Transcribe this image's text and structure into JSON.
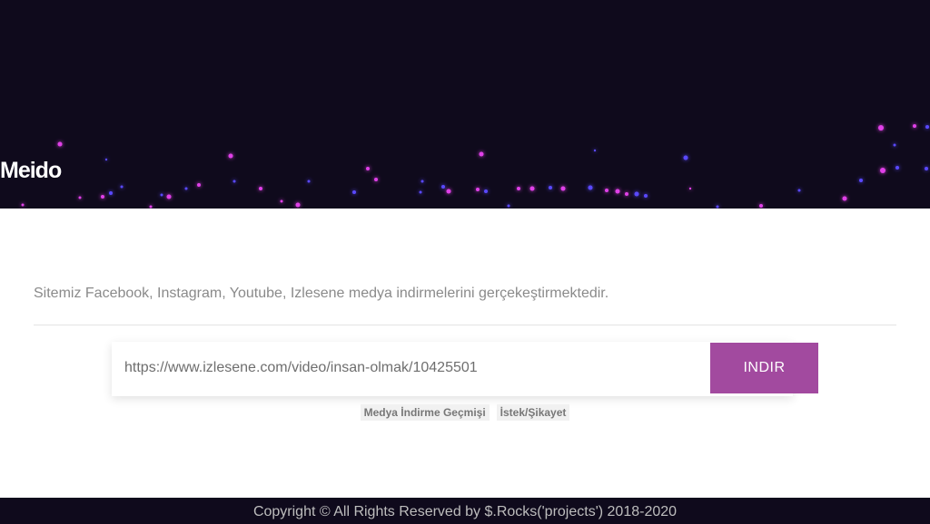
{
  "brand": {
    "logo": "Meido"
  },
  "main": {
    "intro": "Sitemiz Facebook, Instagram, Youtube, Izlesene medya indirmelerini gerçekeştirmektedir.",
    "url_value": "https://www.izlesene.com/video/insan-olmak/10425501",
    "download_label": "INDIR"
  },
  "links": {
    "history": "Medya İndirme Geçmişi",
    "complaint": "İstek/Şikayet"
  },
  "footer": {
    "copyright": "Copyright © All Rights Reserved by $.Rocks('projects') 2018-2020"
  },
  "colors": {
    "header_bg": "#0f0a1c",
    "accent": "#a24a9f",
    "particle_pink": "#e040e8",
    "particle_blue": "#5a48ff"
  }
}
